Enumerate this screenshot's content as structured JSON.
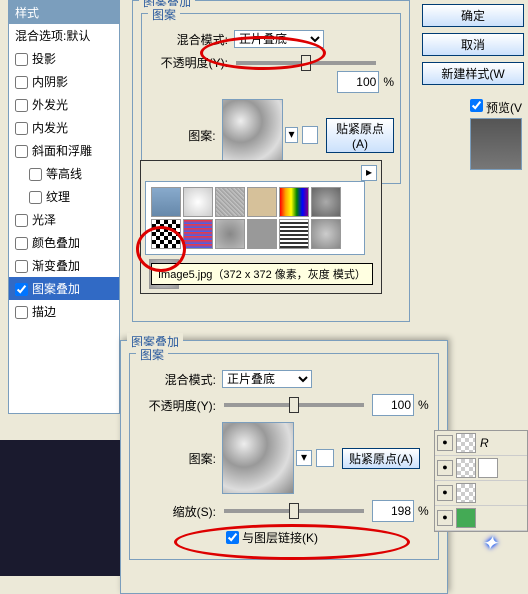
{
  "sidebar": {
    "header": "样式",
    "blendOptions": "混合选项:默认",
    "items": [
      "投影",
      "内阴影",
      "外发光",
      "内发光",
      "斜面和浮雕",
      "等高线",
      "纹理",
      "光泽",
      "颜色叠加",
      "渐变叠加",
      "图案叠加",
      "描边"
    ],
    "selectedIndex": 10
  },
  "panel1": {
    "title": "图案叠加",
    "subtitle": "图案",
    "blendLabel": "混合模式:",
    "blendValue": "正片叠底",
    "opacityLabel": "不透明度(Y):",
    "opacityValue": "100",
    "percent": "%",
    "patternLabel": "图案:",
    "snapBtn": "贴紧原点(A)",
    "tooltip": "Image5.jpg（372 x 372 像素，灰度 模式）"
  },
  "panel2": {
    "title": "图案叠加",
    "subtitle": "图案",
    "blendLabel": "混合模式:",
    "blendValue": "正片叠底",
    "opacityLabel": "不透明度(Y):",
    "opacityValue": "100",
    "percent": "%",
    "patternLabel": "图案:",
    "snapBtn": "贴紧原点(A)",
    "scaleLabel": "缩放(S):",
    "scaleValue": "198",
    "linkLabel": "与图层链接(K)"
  },
  "rightBtns": {
    "ok": "确定",
    "cancel": "取消",
    "newStyle": "新建样式(W",
    "preview": "预览(V"
  },
  "layers": {
    "r": "R"
  }
}
